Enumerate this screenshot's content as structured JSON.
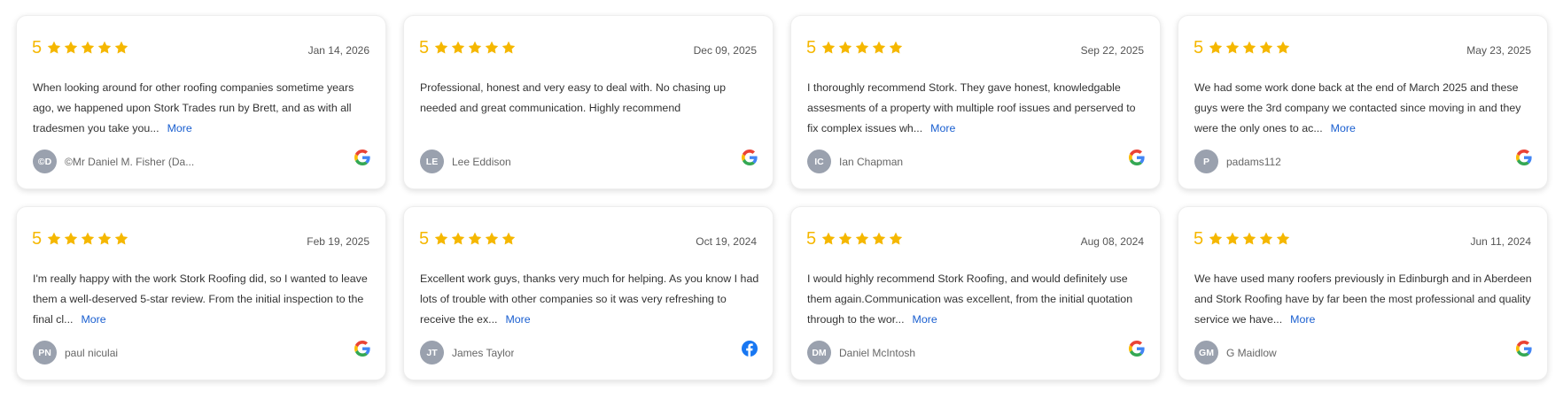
{
  "colors": {
    "star": "#f5b700",
    "more_link": "#1a5fd0",
    "avatar_bg": "#9aa1ae",
    "facebook": "#1877f2"
  },
  "more_label": "More",
  "reviews": [
    {
      "rating": "5",
      "stars": 5,
      "date": "Jan 14, 2026",
      "text": "When looking around for other roofing companies sometime years ago, we happened upon Stork Trades run by Brett, and as with all tradesmen you take you...",
      "initials": "©D",
      "author": "©Mr Daniel M. Fisher (Da...",
      "source": "google-icon"
    },
    {
      "rating": "5",
      "stars": 5,
      "date": "Dec 09, 2025",
      "text": "Professional, honest and very easy to deal with. No chasing up needed and great communication. Highly recommend",
      "initials": "LE",
      "author": "Lee Eddison",
      "source": "google-icon"
    },
    {
      "rating": "5",
      "stars": 5,
      "date": "Sep 22, 2025",
      "text": "I thoroughly recommend Stork. They gave honest, knowledgable assesments of a property with multiple roof issues and perserved to fix complex issues wh...",
      "initials": "IC",
      "author": "Ian Chapman",
      "source": "google-icon"
    },
    {
      "rating": "5",
      "stars": 5,
      "date": "May 23, 2025",
      "text": "We had some work done back at the end of March 2025 and these guys were the 3rd company we contacted since moving in and they were the only ones to ac...",
      "initials": "P",
      "author": "padams112",
      "source": "google-icon"
    },
    {
      "rating": "5",
      "stars": 5,
      "date": "Feb 19, 2025",
      "text": "I'm really happy with the work Stork Roofing did, so I wanted to leave them a well-deserved 5-star review. From the initial inspection to the final cl...",
      "initials": "PN",
      "author": "paul niculai",
      "source": "google-icon"
    },
    {
      "rating": "5",
      "stars": 5,
      "date": "Oct 19, 2024",
      "text": "Excellent work guys, thanks very much for helping. As you know I had lots of trouble with other companies so it was very refreshing to receive the ex...",
      "initials": "JT",
      "author": "James Taylor",
      "source": "facebook-icon"
    },
    {
      "rating": "5",
      "stars": 5,
      "date": "Aug 08, 2024",
      "text": "I would highly recommend Stork Roofing, and would definitely use them again.Communication was excellent, from the initial quotation through to the wor...",
      "initials": "DM",
      "author": "Daniel McIntosh",
      "source": "google-icon"
    },
    {
      "rating": "5",
      "stars": 5,
      "date": "Jun 11, 2024",
      "text": "We have used many roofers previously in Edinburgh and in Aberdeen and Stork Roofing have by far been the most professional and quality service we have...",
      "initials": "GM",
      "author": "G Maidlow",
      "source": "google-icon"
    }
  ]
}
